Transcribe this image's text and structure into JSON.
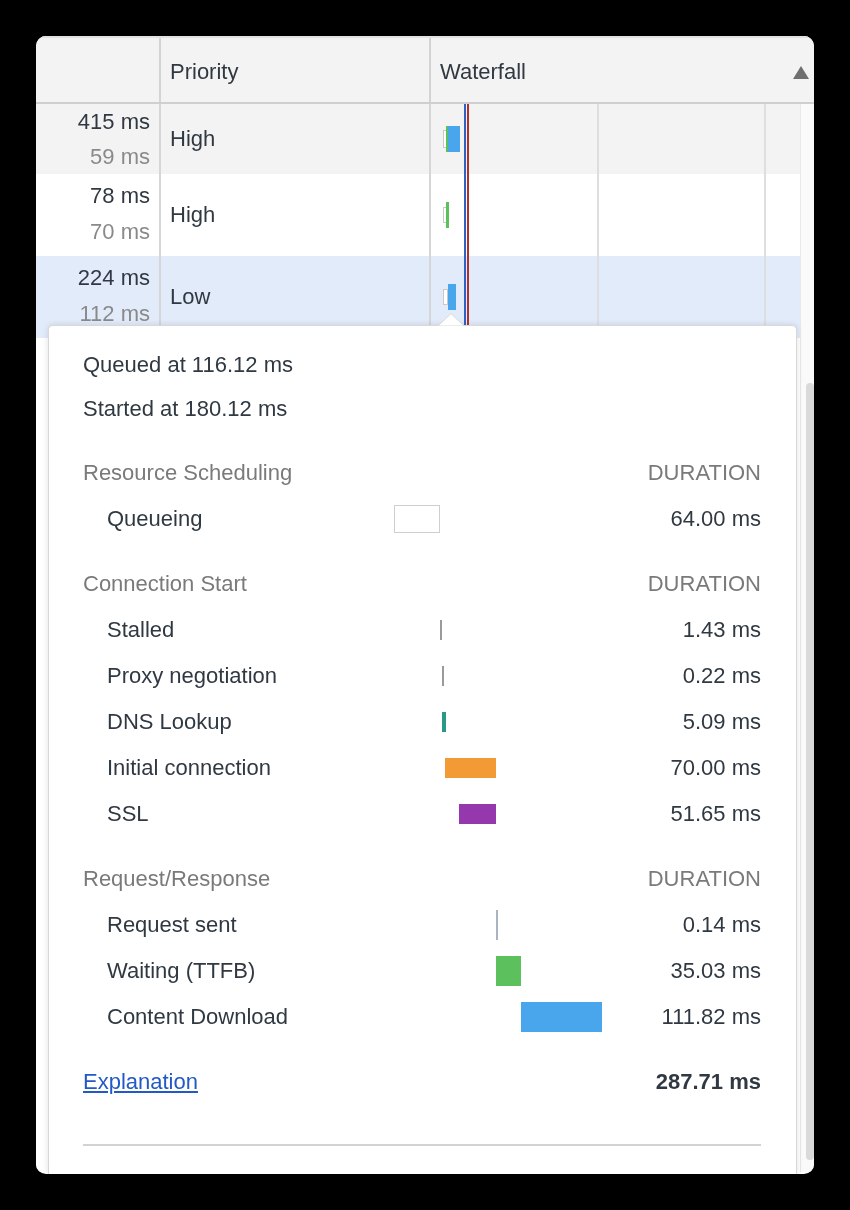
{
  "table": {
    "columns": [
      {
        "label": "Priority",
        "sorted": false
      },
      {
        "label": "Waterfall",
        "sorted": true
      }
    ],
    "rows": [
      {
        "column_1": [
          "415 ms",
          "59 ms"
        ],
        "priority": "High",
        "selected": false
      },
      {
        "column_1": [
          "78 ms",
          "70 ms"
        ],
        "priority": "High",
        "selected": false
      },
      {
        "column_1": [
          "224 ms",
          "112 ms"
        ],
        "priority": "Low",
        "selected": true
      }
    ]
  },
  "popover": {
    "queued": "Queued at 116.12 ms",
    "started": "Started at 180.12 ms",
    "sections": [
      {
        "title": "Resource Scheduling",
        "duration_label": "DURATION",
        "phases": [
          {
            "label": "Queueing",
            "kind": "outline",
            "color": "#ffffff",
            "value": "64.00 ms"
          }
        ]
      },
      {
        "title": "Connection Start",
        "duration_label": "DURATION",
        "phases": [
          {
            "label": "Stalled",
            "kind": "bar",
            "color": "#9a9a9a",
            "value": "1.43 ms"
          },
          {
            "label": "Proxy negotiation",
            "kind": "bar",
            "color": "#9a9a9a",
            "value": "0.22 ms"
          },
          {
            "label": "DNS Lookup",
            "kind": "bar",
            "color": "#2a9886",
            "value": "5.09 ms"
          },
          {
            "label": "Initial connection",
            "kind": "bar",
            "color": "#f29a36",
            "value": "70.00 ms"
          },
          {
            "label": "SSL",
            "kind": "bar",
            "color": "#9538ad",
            "value": "51.65 ms"
          }
        ]
      },
      {
        "title": "Request/Response",
        "duration_label": "DURATION",
        "phases": [
          {
            "label": "Request sent",
            "kind": "bar",
            "color": "#a9b4c0",
            "value": "0.14 ms"
          },
          {
            "label": "Waiting (TTFB)",
            "kind": "bar",
            "color": "#5cc15c",
            "value": "35.03 ms"
          },
          {
            "label": "Content Download",
            "kind": "bar",
            "color": "#4aa6ec",
            "value": "111.82 ms"
          }
        ]
      }
    ],
    "explanation": "Explanation",
    "total": "287.71 ms"
  }
}
